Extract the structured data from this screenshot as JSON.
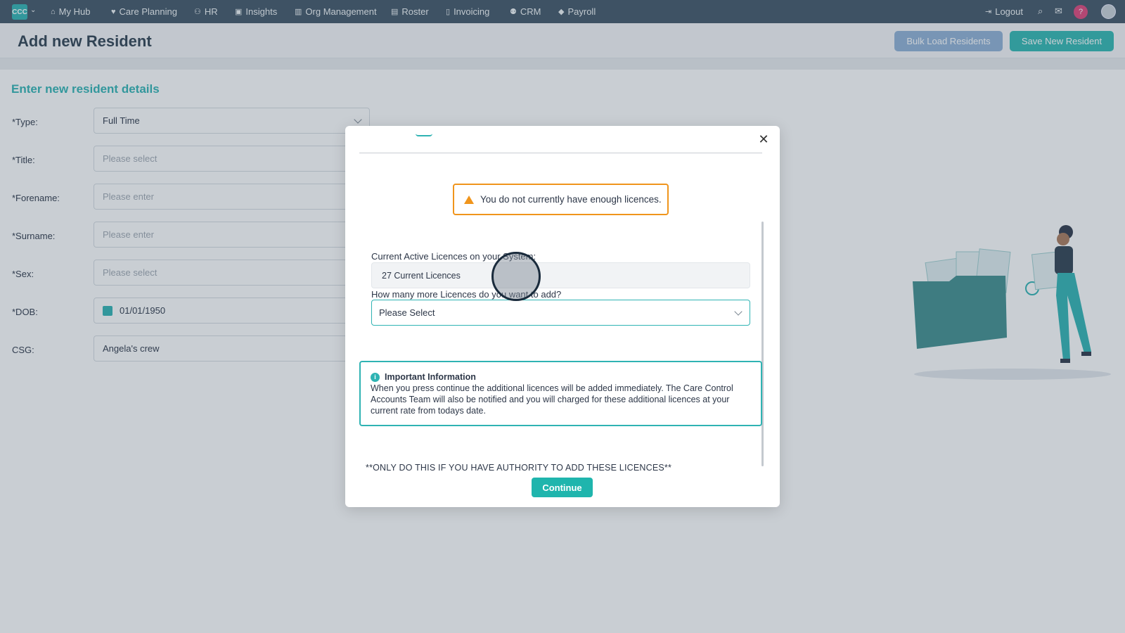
{
  "nav": {
    "logo": "CCC",
    "items": [
      "My Hub",
      "Care Planning",
      "HR",
      "Insights",
      "Org Management",
      "Roster",
      "Invoicing",
      "CRM",
      "Payroll"
    ],
    "logout": "Logout",
    "help": "?"
  },
  "header": {
    "title": "Add new Resident",
    "bulk_label": "Bulk Load Residents",
    "save_label": "Save New Resident"
  },
  "form": {
    "section_title": "Enter new resident details",
    "fields": [
      {
        "label": "*Type:",
        "value": "Full Time"
      },
      {
        "label": "*Title:",
        "value": "Please select"
      },
      {
        "label": "*Forename:",
        "value": "Please enter"
      },
      {
        "label": "*Surname:",
        "value": "Please enter"
      },
      {
        "label": "*Sex:",
        "value": "Please select"
      },
      {
        "label": "*DOB:",
        "value": "01/01/1950"
      },
      {
        "label": "CSG:",
        "value": "Angela's crew"
      }
    ]
  },
  "modal": {
    "warning": "You do not currently have enough licences.",
    "current_label": "Current Active Licences on your System:",
    "current_value": "27 Current Licences",
    "more_label": "How many more Licences do you want to add?",
    "more_value": "Please Select",
    "info_title": "Important Information",
    "info_text": "When you press continue the additional licences will be added immediately. The Care Control Accounts Team will also be notified and you will charged for these additional licences at your current rate from todays date.",
    "authority": "**ONLY DO THIS IF YOU HAVE AUTHORITY TO ADD THESE LICENCES**",
    "continue_label": "Continue"
  },
  "colors": {
    "nav_bg": "#3f5466",
    "accent": "#2fb3b3",
    "warning": "#f0951c",
    "bulk_btn": "#8fb0d6"
  }
}
